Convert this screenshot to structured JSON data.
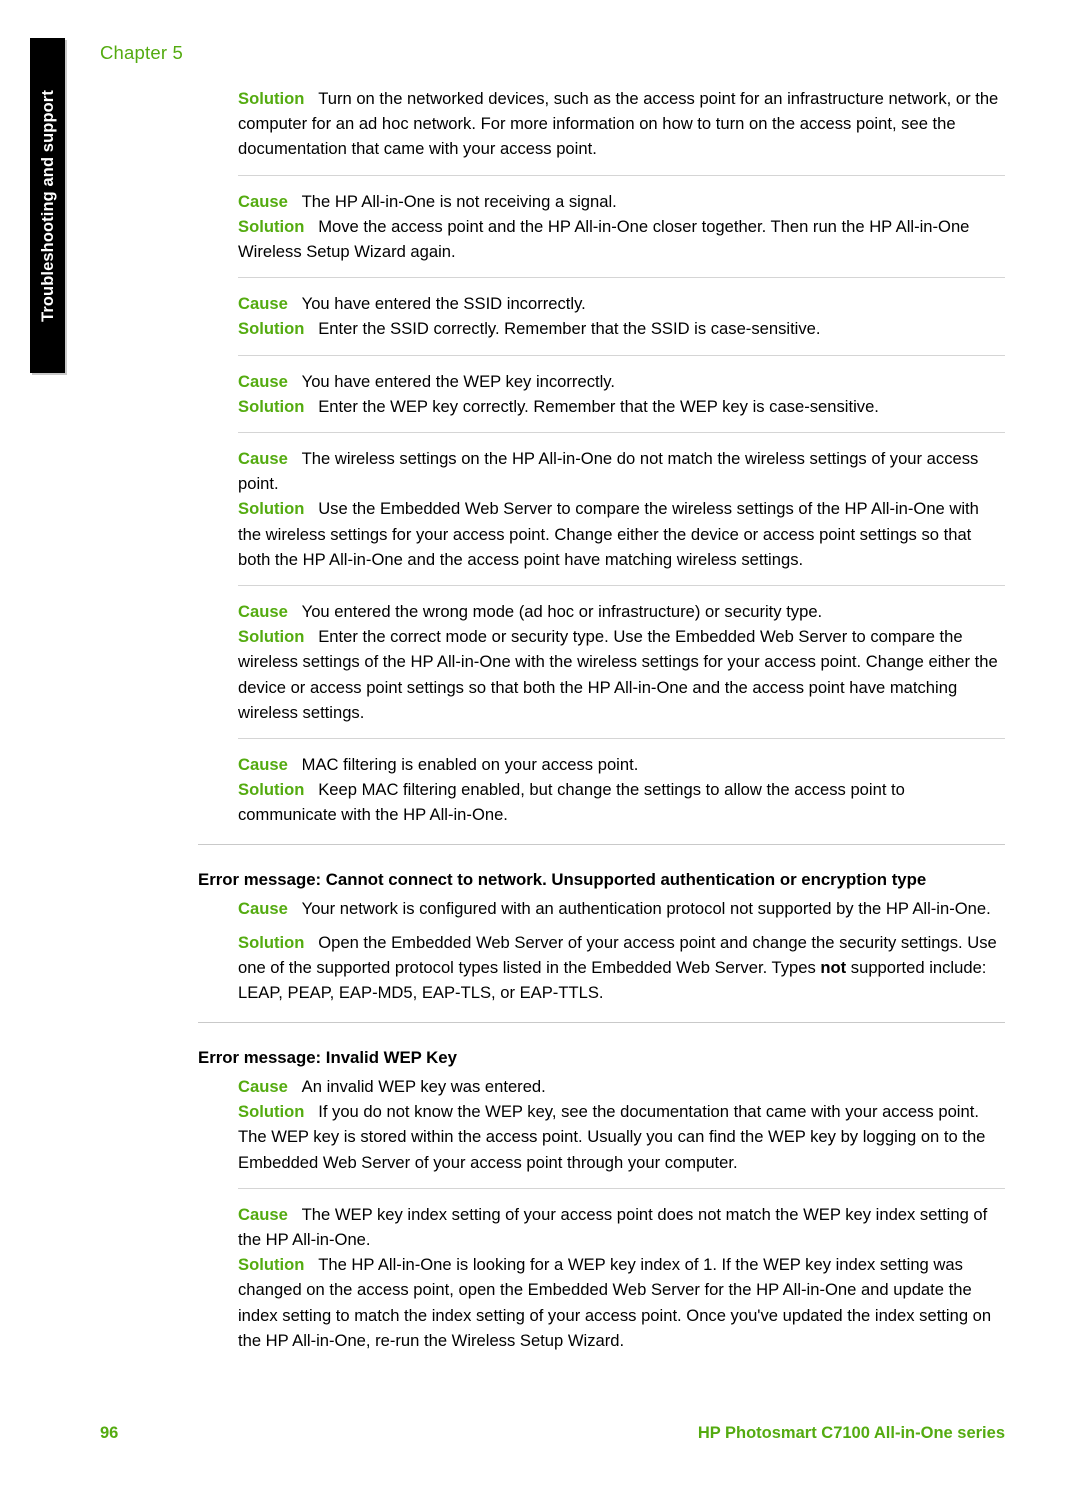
{
  "page": {
    "chapter_label": "Chapter 5",
    "side_tab_label": "Troubleshooting and support",
    "accent_color": "#54ab10",
    "text_color": "#000000",
    "background_color": "#ffffff"
  },
  "labels": {
    "cause": "Cause",
    "solution": "Solution"
  },
  "body": {
    "block1": {
      "solution": "Turn on the networked devices, such as the access point for an infrastructure network, or the computer for an ad hoc network. For more information on how to turn on the access point, see the documentation that came with your access point."
    },
    "block2": {
      "cause": "The HP All-in-One is not receiving a signal.",
      "solution": "Move the access point and the HP All-in-One closer together. Then run the HP All-in-One Wireless Setup Wizard again."
    },
    "block3": {
      "cause": "You have entered the SSID incorrectly.",
      "solution": "Enter the SSID correctly. Remember that the SSID is case-sensitive."
    },
    "block4": {
      "cause": "You have entered the WEP key incorrectly.",
      "solution": "Enter the WEP key correctly. Remember that the WEP key is case-sensitive."
    },
    "block5": {
      "cause": "The wireless settings on the HP All-in-One do not match the wireless settings of your access point.",
      "solution": "Use the Embedded Web Server to compare the wireless settings of the HP All-in-One with the wireless settings for your access point. Change either the device or access point settings so that both the HP All-in-One and the access point have matching wireless settings."
    },
    "block6": {
      "cause": "You entered the wrong mode (ad hoc or infrastructure) or security type.",
      "solution": "Enter the correct mode or security type. Use the Embedded Web Server to compare the wireless settings of the HP All-in-One with the wireless settings for your access point. Change either the device or access point settings so that both the HP All-in-One and the access point have matching wireless settings."
    },
    "block7": {
      "cause": "MAC filtering is enabled on your access point.",
      "solution": "Keep MAC filtering enabled, but change the settings to allow the access point to communicate with the HP All-in-One."
    },
    "section_unsupported_auth": {
      "heading": "Error message: Cannot connect to network. Unsupported authentication or encryption type",
      "cause": "Your network is configured with an authentication protocol not supported by the HP All-in-One.",
      "solution_part1": "Open the Embedded Web Server of your access point and change the security settings. Use one of the supported protocol types listed in the Embedded Web Server. Types ",
      "solution_emphasis": "not",
      "solution_part2": " supported include: LEAP, PEAP, EAP-MD5, EAP-TLS, or EAP-TTLS."
    },
    "section_invalid_wep": {
      "heading": "Error message: Invalid WEP Key",
      "block1": {
        "cause": "An invalid WEP key was entered.",
        "solution": "If you do not know the WEP key, see the documentation that came with your access point. The WEP key is stored within the access point. Usually you can find the WEP key by logging on to the Embedded Web Server of your access point through your computer."
      },
      "block2": {
        "cause": "The WEP key index setting of your access point does not match the WEP key index setting of the HP All-in-One.",
        "solution": "The HP All-in-One is looking for a WEP key index of 1. If the WEP key index setting was changed on the access point, open the Embedded Web Server for the HP All-in-One and update the index setting to match the index setting of your access point. Once you've updated the index setting on the HP All-in-One, re-run the Wireless Setup Wizard."
      }
    }
  },
  "footer": {
    "page_number": "96",
    "product": "HP Photosmart C7100 All-in-One series"
  }
}
